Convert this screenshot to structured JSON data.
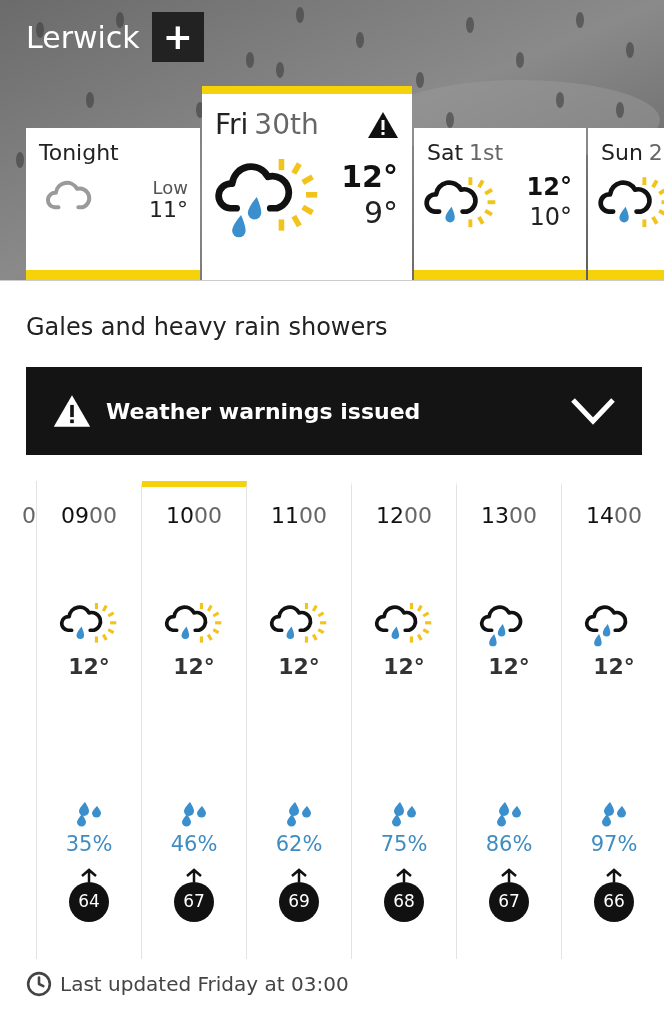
{
  "location": {
    "title": "Lerwick",
    "add_button": "+"
  },
  "days": [
    {
      "kind": "cloudy",
      "label": "Tonight",
      "low_label": "Low",
      "low": "11°",
      "selected": false
    },
    {
      "kind": "heavy_shower_day",
      "day": "Fri",
      "date": "30th",
      "high": "12°",
      "low": "9°",
      "warning": true,
      "selected": true
    },
    {
      "kind": "light_shower_day",
      "day": "Sat",
      "date": "1st",
      "high": "12°",
      "low": "10°",
      "warning": false,
      "selected": false
    },
    {
      "kind": "light_shower_day",
      "day": "Sun",
      "date": "2",
      "selected": false
    }
  ],
  "summary": "Gales and heavy rain showers",
  "warning_banner": {
    "text": "Weather warnings issued"
  },
  "partial_hour": {
    "hour": "0"
  },
  "hours": [
    {
      "hour": "**09**00",
      "kind": "light_shower_day",
      "temp": "12°",
      "rain": "35%",
      "wind": "64",
      "selected": false
    },
    {
      "hour": "**10**00",
      "kind": "light_shower_day",
      "temp": "12°",
      "rain": "46%",
      "wind": "67",
      "selected": true
    },
    {
      "hour": "**11**00",
      "kind": "light_shower_day",
      "temp": "12°",
      "rain": "62%",
      "wind": "69",
      "selected": false
    },
    {
      "hour": "**12**00",
      "kind": "light_shower_day",
      "temp": "12°",
      "rain": "75%",
      "wind": "68",
      "selected": false
    },
    {
      "hour": "**13**00",
      "kind": "light_rain",
      "temp": "12°",
      "rain": "86%",
      "wind": "67",
      "selected": false
    },
    {
      "hour": "**14**00",
      "kind": "light_rain",
      "temp": "12°",
      "rain": "97%",
      "wind": "66",
      "selected": false
    }
  ],
  "last_updated": "Last updated Friday at 03:00"
}
